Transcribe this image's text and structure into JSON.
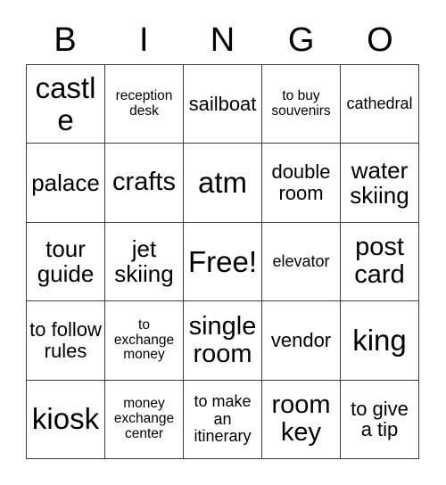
{
  "card": {
    "title": "BINGO Card",
    "header_letters": [
      "B",
      "I",
      "N",
      "G",
      "O"
    ],
    "free_space_label": "Free!",
    "grid_line_color": "#3a3a3a",
    "text_color": "#000000",
    "background_color": "#ffffff",
    "rows": 5,
    "columns": 5,
    "cells": [
      [
        {
          "text": "castle",
          "size": "xxl"
        },
        {
          "text": "reception desk",
          "size": "xs"
        },
        {
          "text": "sailboat",
          "size": "md"
        },
        {
          "text": "to buy souvenirs",
          "size": "xs"
        },
        {
          "text": "cathedral",
          "size": "sm"
        }
      ],
      [
        {
          "text": "palace",
          "size": "lg"
        },
        {
          "text": "crafts",
          "size": "xl"
        },
        {
          "text": "atm",
          "size": "xxl"
        },
        {
          "text": "double room",
          "size": "md"
        },
        {
          "text": "water skiing",
          "size": "lg"
        }
      ],
      [
        {
          "text": "tour guide",
          "size": "lg"
        },
        {
          "text": "jet skiing",
          "size": "lg"
        },
        {
          "text": "Free!",
          "size": "xxl"
        },
        {
          "text": "elevator",
          "size": "sm"
        },
        {
          "text": "post card",
          "size": "xl"
        }
      ],
      [
        {
          "text": "to follow rules",
          "size": "md"
        },
        {
          "text": "to exchange money",
          "size": "xs"
        },
        {
          "text": "single room",
          "size": "xl"
        },
        {
          "text": "vendor",
          "size": "md"
        },
        {
          "text": "king",
          "size": "xxl"
        }
      ],
      [
        {
          "text": "kiosk",
          "size": "xxl"
        },
        {
          "text": "money exchange center",
          "size": "xs"
        },
        {
          "text": "to make an itinerary",
          "size": "sm"
        },
        {
          "text": "room key",
          "size": "xl"
        },
        {
          "text": "to give a tip",
          "size": "md"
        }
      ]
    ]
  }
}
